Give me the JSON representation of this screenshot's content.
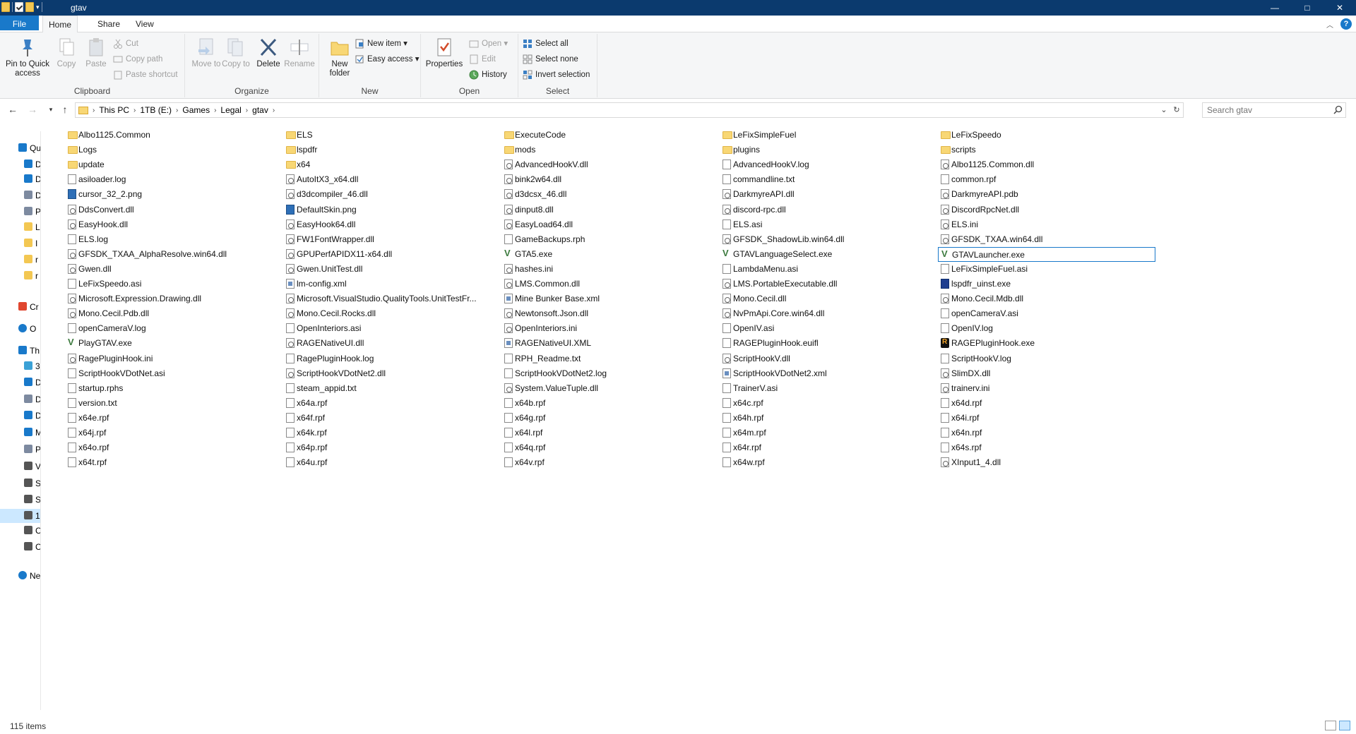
{
  "window": {
    "title": "gtav",
    "controls": {
      "minimize": "—",
      "maximize": "□",
      "close": "✕"
    }
  },
  "ribbon_tabs": [
    "File",
    "Home",
    "Share",
    "View"
  ],
  "ribbon": {
    "clipboard": {
      "label": "Clipboard",
      "pin": "Pin to Quick access",
      "copy": "Copy",
      "paste": "Paste",
      "cut": "Cut",
      "copy_path": "Copy path",
      "paste_shortcut": "Paste shortcut"
    },
    "organize": {
      "label": "Organize",
      "move_to": "Move to",
      "copy_to": "Copy to",
      "delete": "Delete",
      "rename": "Rename"
    },
    "new": {
      "label": "New",
      "new_folder": "New folder",
      "new_item": "New item",
      "easy_access": "Easy access"
    },
    "open": {
      "label": "Open",
      "properties": "Properties",
      "open": "Open",
      "edit": "Edit",
      "history": "History"
    },
    "select": {
      "label": "Select",
      "select_all": "Select all",
      "select_none": "Select none",
      "invert": "Invert selection"
    }
  },
  "address": {
    "crumbs": [
      "This PC",
      "1TB (E:)",
      "Games",
      "Legal",
      "gtav"
    ],
    "search_placeholder": "Search gtav"
  },
  "sidebar": [
    {
      "label": "Qu",
      "icon": "star-icon",
      "color": "#1979ca"
    },
    {
      "label": "D",
      "icon": "desktop-icon",
      "color": "#1979ca"
    },
    {
      "label": "D",
      "icon": "download-icon",
      "color": "#1979ca"
    },
    {
      "label": "D",
      "icon": "document-icon",
      "color": "#7d8aa0"
    },
    {
      "label": "P",
      "icon": "pictures-icon",
      "color": "#7d8aa0"
    },
    {
      "label": "L",
      "icon": "folder-icon",
      "color": "#f3c752"
    },
    {
      "label": "I",
      "icon": "folder-icon",
      "color": "#f3c752"
    },
    {
      "label": "r",
      "icon": "folder-icon",
      "color": "#f3c752"
    },
    {
      "label": "r",
      "icon": "folder-icon",
      "color": "#f3c752"
    },
    {
      "label": "Cr",
      "icon": "creative-cloud-icon",
      "color": "#e0462f"
    },
    {
      "label": "O",
      "icon": "onedrive-icon",
      "color": "#1979ca"
    },
    {
      "label": "Th",
      "icon": "this-pc-icon",
      "color": "#1979ca"
    },
    {
      "label": "3",
      "icon": "3d-objects-icon",
      "color": "#3ba1d6"
    },
    {
      "label": "D",
      "icon": "desktop-icon",
      "color": "#1979ca"
    },
    {
      "label": "D",
      "icon": "document-icon",
      "color": "#7d8aa0"
    },
    {
      "label": "D",
      "icon": "download-icon",
      "color": "#1979ca"
    },
    {
      "label": "M",
      "icon": "music-icon",
      "color": "#1979ca"
    },
    {
      "label": "P",
      "icon": "pictures-icon",
      "color": "#7d8aa0"
    },
    {
      "label": "V",
      "icon": "videos-icon",
      "color": "#555"
    },
    {
      "label": "S",
      "icon": "drive-icon",
      "color": "#555"
    },
    {
      "label": "S",
      "icon": "drive-icon",
      "color": "#555"
    },
    {
      "label": "1",
      "icon": "drive-icon",
      "color": "#555"
    },
    {
      "label": "C",
      "icon": "drive-icon",
      "color": "#555"
    },
    {
      "label": "C",
      "icon": "drive-icon",
      "color": "#555"
    },
    {
      "label": "Ne",
      "icon": "network-icon",
      "color": "#1979ca"
    }
  ],
  "files": [
    {
      "name": "Albo1125.Common",
      "type": "folder"
    },
    {
      "name": "ELS",
      "type": "folder"
    },
    {
      "name": "ExecuteCode",
      "type": "folder"
    },
    {
      "name": "LeFixSimpleFuel",
      "type": "folder"
    },
    {
      "name": "LeFixSpeedo",
      "type": "folder"
    },
    {
      "name": "Logs",
      "type": "folder"
    },
    {
      "name": "lspdfr",
      "type": "folder"
    },
    {
      "name": "mods",
      "type": "folder"
    },
    {
      "name": "plugins",
      "type": "folder"
    },
    {
      "name": "scripts",
      "type": "folder"
    },
    {
      "name": "update",
      "type": "folder"
    },
    {
      "name": "x64",
      "type": "folder"
    },
    {
      "name": "AdvancedHookV.dll",
      "type": "gear"
    },
    {
      "name": "AdvancedHookV.log",
      "type": "file"
    },
    {
      "name": "Albo1125.Common.dll",
      "type": "gear"
    },
    {
      "name": "asiloader.log",
      "type": "file"
    },
    {
      "name": "AutoItX3_x64.dll",
      "type": "gear"
    },
    {
      "name": "bink2w64.dll",
      "type": "gear"
    },
    {
      "name": "commandline.txt",
      "type": "file"
    },
    {
      "name": "common.rpf",
      "type": "file"
    },
    {
      "name": "cursor_32_2.png",
      "type": "img"
    },
    {
      "name": "d3dcompiler_46.dll",
      "type": "gear"
    },
    {
      "name": "d3dcsx_46.dll",
      "type": "gear"
    },
    {
      "name": "DarkmyreAPI.dll",
      "type": "gear"
    },
    {
      "name": "DarkmyreAPI.pdb",
      "type": "gear"
    },
    {
      "name": "DdsConvert.dll",
      "type": "gear"
    },
    {
      "name": "DefaultSkin.png",
      "type": "img"
    },
    {
      "name": "dinput8.dll",
      "type": "gear"
    },
    {
      "name": "discord-rpc.dll",
      "type": "gear"
    },
    {
      "name": "DiscordRpcNet.dll",
      "type": "gear"
    },
    {
      "name": "EasyHook.dll",
      "type": "gear"
    },
    {
      "name": "EasyHook64.dll",
      "type": "gear"
    },
    {
      "name": "EasyLoad64.dll",
      "type": "gear"
    },
    {
      "name": "ELS.asi",
      "type": "file"
    },
    {
      "name": "ELS.ini",
      "type": "gear"
    },
    {
      "name": "ELS.log",
      "type": "file"
    },
    {
      "name": "FW1FontWrapper.dll",
      "type": "gear"
    },
    {
      "name": "GameBackups.rph",
      "type": "file"
    },
    {
      "name": "GFSDK_ShadowLib.win64.dll",
      "type": "gear"
    },
    {
      "name": "GFSDK_TXAA.win64.dll",
      "type": "gear"
    },
    {
      "name": "GFSDK_TXAA_AlphaResolve.win64.dll",
      "type": "gear"
    },
    {
      "name": "GPUPerfAPIDX11-x64.dll",
      "type": "gear"
    },
    {
      "name": "GTA5.exe",
      "type": "v"
    },
    {
      "name": "GTAVLanguageSelect.exe",
      "type": "v"
    },
    {
      "name": "GTAVLauncher.exe",
      "type": "v",
      "focused": true
    },
    {
      "name": "Gwen.dll",
      "type": "gear"
    },
    {
      "name": "Gwen.UnitTest.dll",
      "type": "gear"
    },
    {
      "name": "hashes.ini",
      "type": "gear"
    },
    {
      "name": "LambdaMenu.asi",
      "type": "file"
    },
    {
      "name": "LeFixSimpleFuel.asi",
      "type": "file"
    },
    {
      "name": "LeFixSpeedo.asi",
      "type": "file"
    },
    {
      "name": "lm-config.xml",
      "type": "xml"
    },
    {
      "name": "LMS.Common.dll",
      "type": "gear"
    },
    {
      "name": "LMS.PortableExecutable.dll",
      "type": "gear"
    },
    {
      "name": "lspdfr_uinst.exe",
      "type": "app"
    },
    {
      "name": "Microsoft.Expression.Drawing.dll",
      "type": "gear"
    },
    {
      "name": "Microsoft.VisualStudio.QualityTools.UnitTestFr...",
      "type": "gear"
    },
    {
      "name": "Mine Bunker Base.xml",
      "type": "xml"
    },
    {
      "name": "Mono.Cecil.dll",
      "type": "gear"
    },
    {
      "name": "Mono.Cecil.Mdb.dll",
      "type": "gear"
    },
    {
      "name": "Mono.Cecil.Pdb.dll",
      "type": "gear"
    },
    {
      "name": "Mono.Cecil.Rocks.dll",
      "type": "gear"
    },
    {
      "name": "Newtonsoft.Json.dll",
      "type": "gear"
    },
    {
      "name": "NvPmApi.Core.win64.dll",
      "type": "gear"
    },
    {
      "name": "openCameraV.asi",
      "type": "file"
    },
    {
      "name": "openCameraV.log",
      "type": "file"
    },
    {
      "name": "OpenInteriors.asi",
      "type": "file"
    },
    {
      "name": "OpenInteriors.ini",
      "type": "gear"
    },
    {
      "name": "OpenIV.asi",
      "type": "file"
    },
    {
      "name": "OpenIV.log",
      "type": "file"
    },
    {
      "name": "PlayGTAV.exe",
      "type": "v"
    },
    {
      "name": "RAGENativeUI.dll",
      "type": "gear"
    },
    {
      "name": "RAGENativeUI.XML",
      "type": "xml"
    },
    {
      "name": "RAGEPluginHook.euifl",
      "type": "file"
    },
    {
      "name": "RAGEPluginHook.exe",
      "type": "rage"
    },
    {
      "name": "RagePluginHook.ini",
      "type": "gear"
    },
    {
      "name": "RagePluginHook.log",
      "type": "file"
    },
    {
      "name": "RPH_Readme.txt",
      "type": "file"
    },
    {
      "name": "ScriptHookV.dll",
      "type": "gear"
    },
    {
      "name": "ScriptHookV.log",
      "type": "file"
    },
    {
      "name": "ScriptHookVDotNet.asi",
      "type": "file"
    },
    {
      "name": "ScriptHookVDotNet2.dll",
      "type": "gear"
    },
    {
      "name": "ScriptHookVDotNet2.log",
      "type": "file"
    },
    {
      "name": "ScriptHookVDotNet2.xml",
      "type": "xml"
    },
    {
      "name": "SlimDX.dll",
      "type": "gear"
    },
    {
      "name": "startup.rphs",
      "type": "file"
    },
    {
      "name": "steam_appid.txt",
      "type": "file"
    },
    {
      "name": "System.ValueTuple.dll",
      "type": "gear"
    },
    {
      "name": "TrainerV.asi",
      "type": "file"
    },
    {
      "name": "trainerv.ini",
      "type": "gear"
    },
    {
      "name": "version.txt",
      "type": "file"
    },
    {
      "name": "x64a.rpf",
      "type": "file"
    },
    {
      "name": "x64b.rpf",
      "type": "file"
    },
    {
      "name": "x64c.rpf",
      "type": "file"
    },
    {
      "name": "x64d.rpf",
      "type": "file"
    },
    {
      "name": "x64e.rpf",
      "type": "file"
    },
    {
      "name": "x64f.rpf",
      "type": "file"
    },
    {
      "name": "x64g.rpf",
      "type": "file"
    },
    {
      "name": "x64h.rpf",
      "type": "file"
    },
    {
      "name": "x64i.rpf",
      "type": "file"
    },
    {
      "name": "x64j.rpf",
      "type": "file"
    },
    {
      "name": "x64k.rpf",
      "type": "file"
    },
    {
      "name": "x64l.rpf",
      "type": "file"
    },
    {
      "name": "x64m.rpf",
      "type": "file"
    },
    {
      "name": "x64n.rpf",
      "type": "file"
    },
    {
      "name": "x64o.rpf",
      "type": "file"
    },
    {
      "name": "x64p.rpf",
      "type": "file"
    },
    {
      "name": "x64q.rpf",
      "type": "file"
    },
    {
      "name": "x64r.rpf",
      "type": "file"
    },
    {
      "name": "x64s.rpf",
      "type": "file"
    },
    {
      "name": "x64t.rpf",
      "type": "file"
    },
    {
      "name": "x64u.rpf",
      "type": "file"
    },
    {
      "name": "x64v.rpf",
      "type": "file"
    },
    {
      "name": "x64w.rpf",
      "type": "file"
    },
    {
      "name": "XInput1_4.dll",
      "type": "gear"
    }
  ],
  "status": {
    "count": "115 items"
  }
}
